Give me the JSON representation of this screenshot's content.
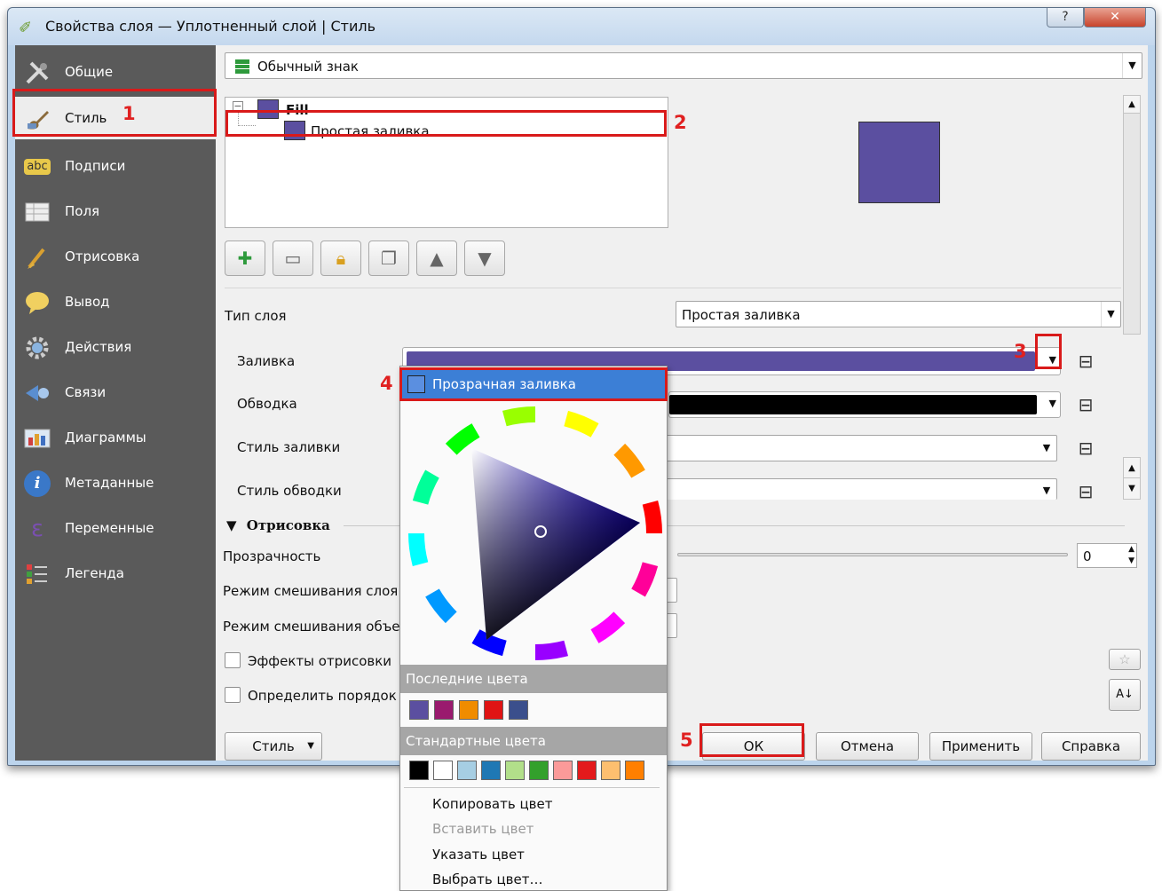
{
  "window": {
    "title": "Свойства слоя — Уплотненный слой | Стиль",
    "help_glyph": "?",
    "close_glyph": "✕"
  },
  "sidebar": {
    "items": [
      {
        "label": "Общие",
        "icon": "tools-icon"
      },
      {
        "label": "Стиль",
        "icon": "paintbrush-icon"
      },
      {
        "label": "Подписи",
        "icon": "abc-label-icon",
        "icon_text": "abc"
      },
      {
        "label": "Поля",
        "icon": "table-icon"
      },
      {
        "label": "Отрисовка",
        "icon": "brush-icon"
      },
      {
        "label": "Вывод",
        "icon": "speech-bubble-icon"
      },
      {
        "label": "Действия",
        "icon": "gear-icon"
      },
      {
        "label": "Связи",
        "icon": "join-icon"
      },
      {
        "label": "Диаграммы",
        "icon": "diagram-icon"
      },
      {
        "label": "Метаданные",
        "icon": "info-icon",
        "icon_text": "i"
      },
      {
        "label": "Переменные",
        "icon": "epsilon-icon",
        "icon_text": "ε"
      },
      {
        "label": "Легенда",
        "icon": "legend-icon"
      }
    ]
  },
  "renderer": {
    "selected": "Обычный знак"
  },
  "symbol_tree": {
    "root": "Fill",
    "child": "Простая заливка"
  },
  "layer": {
    "type_label": "Тип слоя",
    "type_value": "Простая заливка",
    "fill_label": "Заливка",
    "stroke_label": "Обводка",
    "fill_style_label": "Стиль заливки",
    "stroke_style_label": "Стиль обводки"
  },
  "rendering": {
    "section_label": "Отрисовка",
    "opacity_label": "Прозрачность",
    "opacity_value": "0",
    "layer_blend_label": "Режим смешивания слоя",
    "object_blend_label": "Режим смешивания объект",
    "effects_label": "Эффекты отрисовки",
    "order_label": "Определить порядок с"
  },
  "buttons": {
    "style": "Стиль",
    "ok": "ОК",
    "cancel": "Отмена",
    "apply": "Применить",
    "help": "Справка"
  },
  "color_popup": {
    "transparent": "Прозрачная заливка",
    "recent_header": "Последние цвета",
    "recent_colors": [
      "#5b4fa0",
      "#9a1a6e",
      "#f08c00",
      "#e01414",
      "#3b4f8c"
    ],
    "standard_header": "Стандартные цвета",
    "standard_colors": [
      "#000000",
      "#ffffff",
      "#a6cee3",
      "#1f78b4",
      "#b2df8a",
      "#33a02c",
      "#fb9a99",
      "#e31a1c",
      "#fdbf6f",
      "#ff7f00"
    ],
    "menu": [
      {
        "label": "Копировать цвет",
        "enabled": true
      },
      {
        "label": "Вставить цвет",
        "enabled": false
      },
      {
        "label": "Указать цвет",
        "enabled": true
      },
      {
        "label": "Выбрать цвет…",
        "enabled": true
      }
    ]
  },
  "annotations": [
    "1",
    "2",
    "3",
    "4",
    "5"
  ],
  "colors": {
    "fill": "#5b4fa0",
    "stroke": "#000000",
    "annotation": "#d91a1a",
    "sidebar": "#5a5a5a"
  }
}
